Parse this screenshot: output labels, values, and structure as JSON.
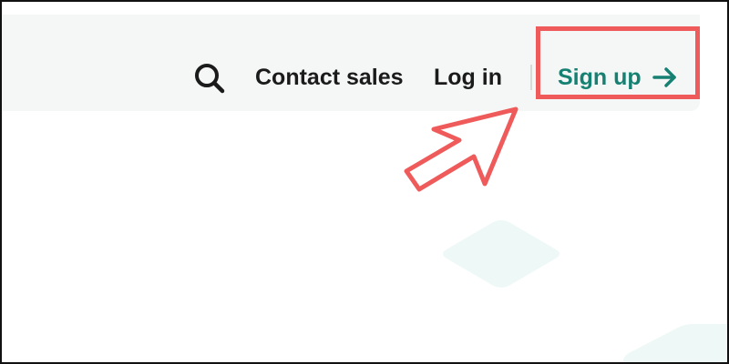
{
  "nav": {
    "search_icon": "search-icon",
    "contact_sales": "Contact sales",
    "log_in": "Log in",
    "sign_up": "Sign up",
    "sign_up_icon": "arrow-right-icon"
  },
  "annotation": {
    "highlight_color": "#ef5b5b",
    "pointer_icon": "pointer-arrow-icon"
  },
  "colors": {
    "accent": "#168172",
    "text": "#1b1b1b",
    "navbar_bg": "#f5f7f6",
    "decor": "#eef9f7"
  }
}
